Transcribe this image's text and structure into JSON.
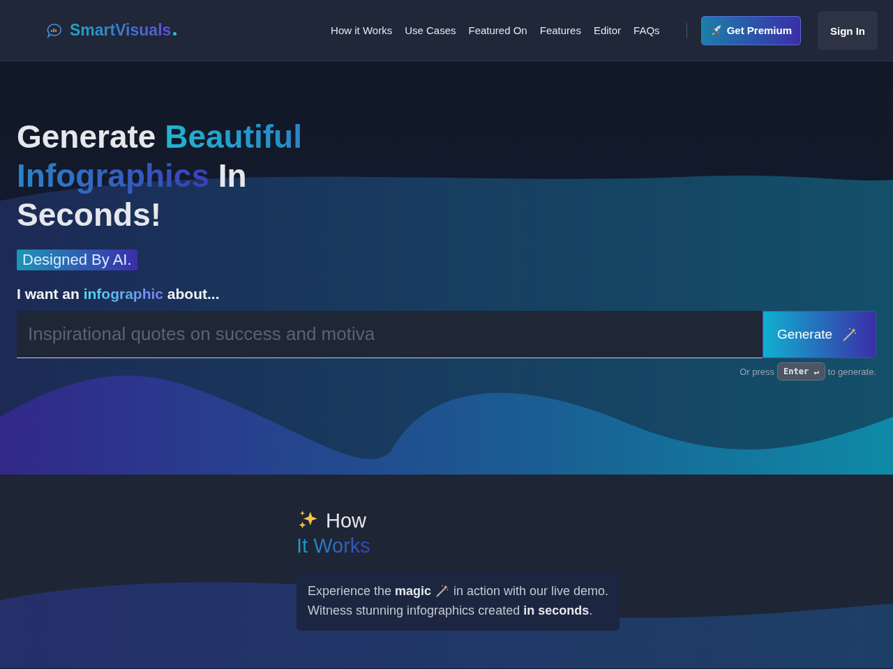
{
  "nav": {
    "brand": "SmartVisuals",
    "links": [
      {
        "label": "How it Works"
      },
      {
        "label": "Use Cases"
      },
      {
        "label": "Featured On"
      },
      {
        "label": "Features"
      },
      {
        "label": "Editor"
      },
      {
        "label": "FAQs"
      }
    ],
    "premium_button": "Get Premium",
    "signin_button": "Sign In"
  },
  "hero": {
    "heading": [
      {
        "text": "Generate ",
        "accent": false
      },
      {
        "text": "Beautiful Infographics",
        "accent": true
      },
      {
        "text": " In Seconds!",
        "accent": false
      }
    ],
    "badge": "Designed By AI.",
    "prompt": [
      {
        "text": "I want an ",
        "accent": false
      },
      {
        "text": "infographic",
        "accent": true
      },
      {
        "text": " about...",
        "accent": false
      }
    ],
    "input": {
      "placeholder": "Inspirational quotes on success and motiva"
    },
    "generate_button": "Generate",
    "hint": {
      "before": "Or press",
      "key": "Enter ↵",
      "after": "to generate."
    }
  },
  "how": {
    "title_first": "How",
    "title_second": "It Works",
    "description_before": "Experience the **magic**",
    "description_after": "in action with our live demo.",
    "description_second_line": "Witness stunning infographics created **in seconds**."
  }
}
